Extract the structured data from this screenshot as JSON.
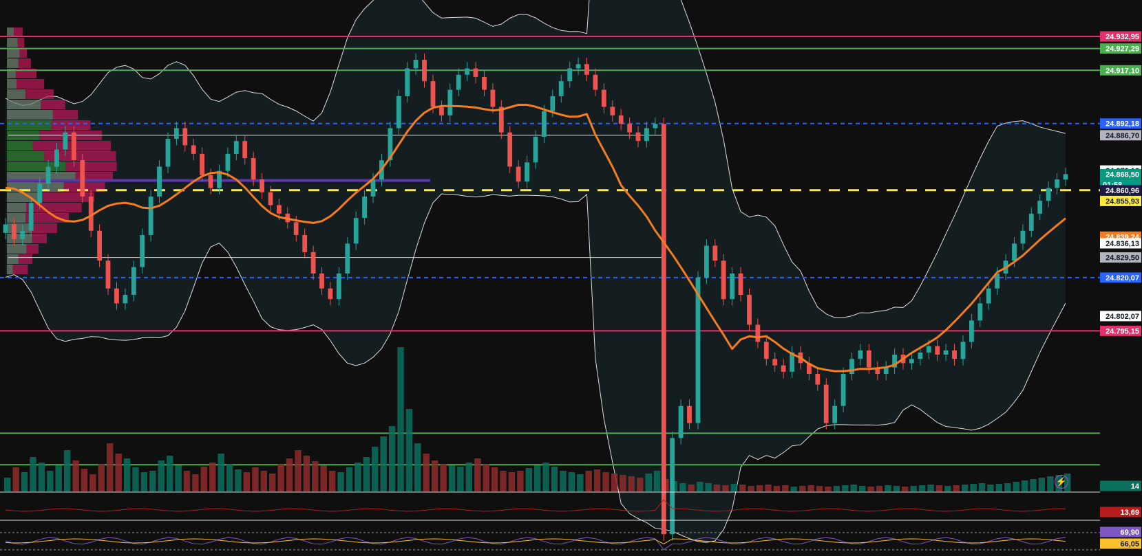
{
  "chart_data": {
    "type": "candlestick",
    "price_axis": {
      "min": 24.72,
      "max": 24.95,
      "decimal_separator": ","
    },
    "price_levels": [
      {
        "label": "24.932,95",
        "value": 24.93295,
        "color": "#e3306b",
        "style": "solid"
      },
      {
        "label": "24.927,29",
        "value": 24.92729,
        "color": "#4caf50",
        "style": "solid"
      },
      {
        "label": "24.917,10",
        "value": 24.9171,
        "color": "#4caf50",
        "style": "solid"
      },
      {
        "label": "24.892,18",
        "value": 24.89218,
        "color": "#2962ff",
        "style": "dashed"
      },
      {
        "label": "24.860,96",
        "value": 24.86096,
        "color": "#ffeb3b",
        "style": "dashed"
      },
      {
        "label": "24.820,07",
        "value": 24.82007,
        "color": "#2962ff",
        "style": "dashed"
      },
      {
        "label": "24.795,15",
        "value": 24.79515,
        "color": "#e3306b",
        "style": "solid"
      },
      {
        "label": "24.747,20",
        "value": 24.7472,
        "color": "#4caf50",
        "style": "solid"
      },
      {
        "label": "24.732,47",
        "value": 24.73247,
        "color": "#4caf50",
        "style": "solid"
      }
    ],
    "axis_badges": [
      {
        "label": "24.932,95",
        "value": 24.93295,
        "bg": "#e3306b",
        "fg": "#ffffff"
      },
      {
        "label": "24.927,29",
        "value": 24.92729,
        "bg": "#4caf50",
        "fg": "#ffffff"
      },
      {
        "label": "24.917,10",
        "value": 24.9171,
        "bg": "#4caf50",
        "fg": "#ffffff"
      },
      {
        "label": "24.892,18",
        "value": 24.89218,
        "bg": "#2962ff",
        "fg": "#ffffff"
      },
      {
        "label": "24.886,70",
        "value": 24.8867,
        "bg": "#b2b5be",
        "fg": "#131722"
      },
      {
        "label": "24.870,18",
        "value": 24.87018,
        "bg": "#ffffff",
        "fg": "#131722"
      },
      {
        "label": "24.868,50",
        "value": 24.8685,
        "bg": "#089981",
        "fg": "#ffffff",
        "sub": "01:58"
      },
      {
        "label": "24.860,96",
        "value": 24.86096,
        "bg": "#1e1b4b",
        "fg": "#ffffff"
      },
      {
        "label": "24.855,93",
        "value": 24.85593,
        "bg": "#ffeb3b",
        "fg": "#131722"
      },
      {
        "label": "24.839,24",
        "value": 24.83924,
        "bg": "#f57c1f",
        "fg": "#ffffff"
      },
      {
        "label": "24.836,13",
        "value": 24.83613,
        "bg": "#ffffff",
        "fg": "#131722"
      },
      {
        "label": "24.829,50",
        "value": 24.8295,
        "bg": "#b2b5be",
        "fg": "#131722"
      },
      {
        "label": "24.820,07",
        "value": 24.82007,
        "bg": "#2962ff",
        "fg": "#ffffff"
      },
      {
        "label": "24.802,07",
        "value": 24.80207,
        "bg": "#ffffff",
        "fg": "#131722"
      },
      {
        "label": "24.795,15",
        "value": 24.79515,
        "bg": "#e3306b",
        "fg": "#ffffff"
      }
    ],
    "last_price": {
      "value": 24.8685,
      "label": "24.868,50",
      "countdown": "01:58"
    },
    "close_series": [
      24.845,
      24.838,
      24.842,
      24.855,
      24.864,
      24.872,
      24.88,
      24.888,
      24.875,
      24.858,
      24.842,
      24.828,
      24.815,
      24.808,
      24.812,
      24.825,
      24.84,
      24.858,
      24.872,
      24.885,
      24.89,
      24.882,
      24.878,
      24.868,
      24.862,
      24.87,
      24.878,
      24.884,
      24.876,
      24.866,
      24.86,
      24.854,
      24.85,
      24.846,
      24.84,
      24.832,
      24.822,
      24.815,
      24.81,
      24.822,
      24.836,
      24.848,
      24.858,
      24.866,
      24.875,
      24.89,
      24.905,
      24.918,
      24.922,
      24.912,
      24.9,
      24.896,
      24.908,
      24.915,
      24.918,
      24.914,
      24.908,
      24.9,
      24.888,
      24.872,
      24.865,
      24.874,
      24.886,
      24.898,
      24.905,
      24.912,
      24.918,
      24.92,
      24.915,
      24.908,
      24.9,
      24.896,
      24.892,
      24.888,
      24.884,
      24.89,
      24.892,
      24.7,
      24.745,
      24.76,
      24.752,
      24.82,
      24.835,
      24.828,
      24.81,
      24.822,
      24.812,
      24.798,
      24.79,
      24.782,
      24.779,
      24.776,
      24.785,
      24.78,
      24.775,
      24.77,
      24.752,
      24.76,
      24.775,
      24.782,
      24.786,
      24.778,
      24.775,
      24.778,
      24.784,
      24.78,
      24.782,
      24.785,
      24.788,
      24.784,
      24.786,
      24.782,
      24.79,
      24.8,
      24.808,
      24.815,
      24.822,
      24.828,
      24.836,
      24.842,
      24.85,
      24.856,
      24.862,
      24.866,
      24.8685
    ],
    "volume_series": [
      20,
      35,
      28,
      50,
      42,
      30,
      38,
      60,
      45,
      33,
      25,
      40,
      70,
      55,
      48,
      35,
      28,
      30,
      45,
      52,
      38,
      30,
      25,
      36,
      42,
      55,
      40,
      32,
      28,
      35,
      30,
      26,
      40,
      48,
      60,
      52,
      44,
      38,
      30,
      28,
      35,
      42,
      50,
      65,
      80,
      95,
      210,
      120,
      70,
      55,
      45,
      40,
      38,
      36,
      42,
      48,
      40,
      35,
      30,
      28,
      30,
      34,
      38,
      42,
      36,
      30,
      28,
      25,
      30,
      32,
      28,
      26,
      24,
      22,
      20,
      26,
      30,
      18,
      15,
      12,
      10,
      14,
      12,
      10,
      9,
      11,
      10,
      8,
      9,
      10,
      8,
      9,
      7,
      8,
      9,
      8,
      7,
      8,
      9,
      10,
      8,
      7,
      8,
      9,
      8,
      7,
      8,
      9,
      10,
      9,
      8,
      9,
      10,
      11,
      12,
      10,
      11,
      12,
      14,
      16,
      18,
      20,
      22,
      24,
      26
    ],
    "volume_badge": "14",
    "indicator_pane_1": {
      "label": "13,69",
      "value": 13.69,
      "color": "#b71c1c"
    },
    "indicator_pane_2": {
      "values": [
        {
          "label": "69,90",
          "value": 69.9,
          "color": "#7e57c2"
        },
        {
          "label": "66,05",
          "value": 66.05,
          "color": "#fbc02d"
        }
      ]
    },
    "grid": false
  },
  "ui": {
    "alert_icon": "lightning-bolt-icon"
  }
}
